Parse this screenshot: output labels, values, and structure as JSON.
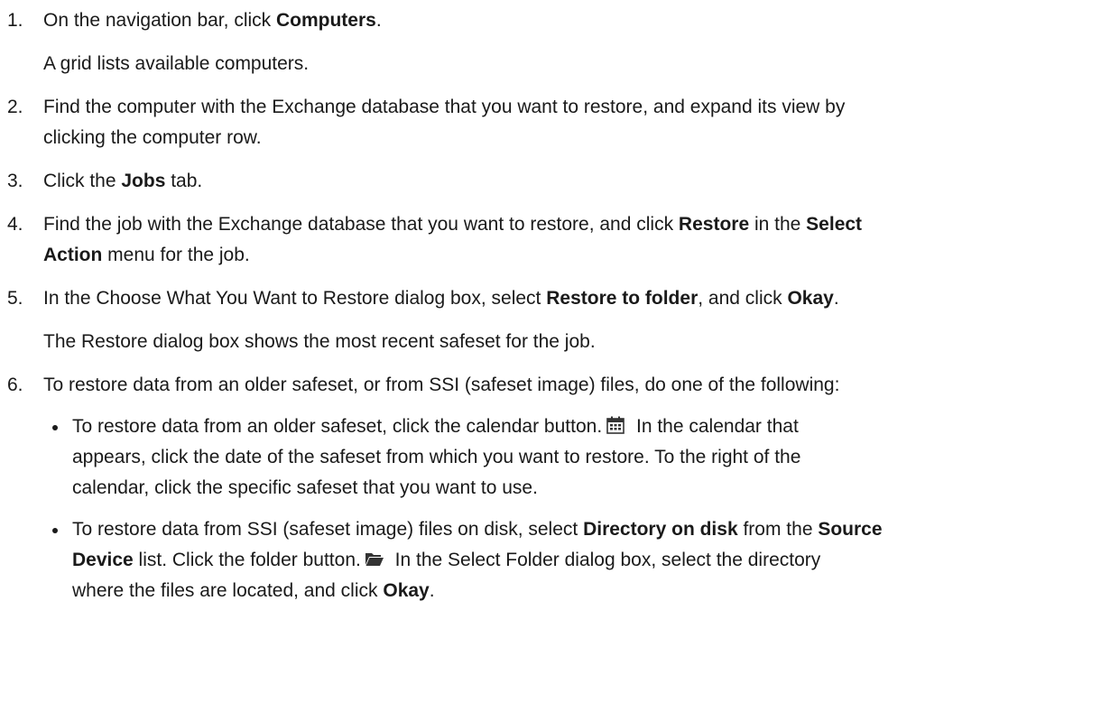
{
  "steps": [
    {
      "num": "1.",
      "text_a": "On the navigation bar, click ",
      "bold_a": "Computers",
      "text_b": ".",
      "note": "A grid lists available computers."
    },
    {
      "num": "2.",
      "line1": "Find the computer with the Exchange database that you want to restore, and expand its view by",
      "line2": "clicking the computer row."
    },
    {
      "num": "3.",
      "text_a": "Click the ",
      "bold_a": "Jobs",
      "text_b": " tab."
    },
    {
      "num": "4.",
      "text_a": "Find the job with the Exchange database that you want to restore, and click ",
      "bold_a": "Restore",
      "text_b": " in the ",
      "bold_b": "Select",
      "bold_c": "Action",
      "text_c": " menu for the job."
    },
    {
      "num": "5.",
      "text_a": "In the Choose What You Want to Restore dialog box, select ",
      "bold_a": "Restore to folder",
      "text_b": ", and click ",
      "bold_b": "Okay",
      "text_c": ".",
      "note": "The Restore dialog box shows the most recent safeset for the job."
    },
    {
      "num": "6.",
      "text_a": "To restore data from an older safeset, or from SSI (safeset image) files, do one of the following:",
      "bullets": [
        {
          "t1": "To restore data from an older safeset, click the calendar button.",
          "icon": "calendar-icon",
          "t2": " In the calendar that",
          "line2": "appears, click the date of the safeset from which you want to restore. To the right of the",
          "line3": "calendar, click the specific safeset that you want to use."
        },
        {
          "t1": "To restore data from SSI (safeset image) files on disk, select ",
          "b1": "Directory on disk",
          "t2": " from the ",
          "b2": "Source",
          "b3": "Device",
          "t3": " list. Click the folder button.",
          "icon": "folder-open-icon",
          "t4": " In the Select Folder dialog box, select the directory",
          "t5": "where the files are located, and click ",
          "b4": "Okay",
          "t6": "."
        }
      ]
    }
  ],
  "colors": {
    "text": "#1a1a1a",
    "icon_dark": "#333333",
    "icon_red": "#c0392b"
  }
}
